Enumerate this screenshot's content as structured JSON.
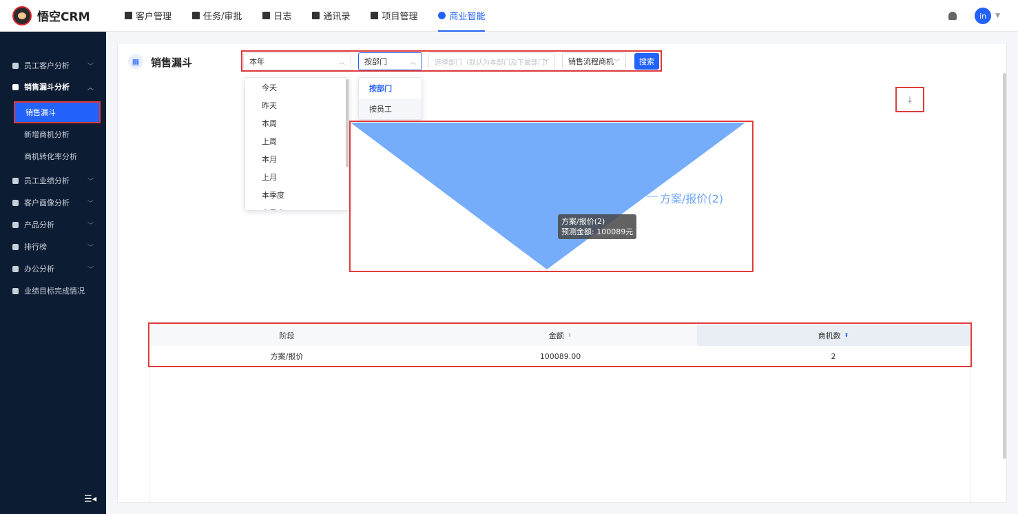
{
  "app": {
    "logo_text": "悟空CRM"
  },
  "nav": {
    "items": [
      {
        "label": "客户管理",
        "icon": "building-icon"
      },
      {
        "label": "任务/审批",
        "icon": "briefcase-icon"
      },
      {
        "label": "日志",
        "icon": "log-icon"
      },
      {
        "label": "通讯录",
        "icon": "contacts-icon"
      },
      {
        "label": "项目管理",
        "icon": "project-icon"
      },
      {
        "label": "商业智能",
        "icon": "bi-icon",
        "active": true
      }
    ]
  },
  "user": {
    "avatar_text": "in"
  },
  "sidebar": {
    "items": [
      {
        "label": "员工客户分析",
        "icon": "user-icon"
      },
      {
        "label": "销售漏斗分析",
        "icon": "funnel-icon",
        "open": true
      },
      {
        "label": "员工业绩分析",
        "icon": "bar-chart-icon"
      },
      {
        "label": "客户画像分析",
        "icon": "users-icon"
      },
      {
        "label": "产品分析",
        "icon": "box-icon"
      },
      {
        "label": "排行榜",
        "icon": "trophy-icon"
      },
      {
        "label": "办公分析",
        "icon": "briefcase-icon"
      },
      {
        "label": "业绩目标完成情况",
        "icon": "target-icon"
      }
    ],
    "sub_items": [
      "销售漏斗",
      "新增商机分析",
      "商机转化率分析"
    ],
    "collapse_glyph": "☰◂"
  },
  "page": {
    "title": "销售漏斗"
  },
  "filters": {
    "time_value": "本年",
    "group_value": "按部门",
    "dept_placeholder": "选择部门（默认为本部门及下属部门）",
    "flow_value": "销售流程商机",
    "search_label": "搜索"
  },
  "time_options": [
    "今天",
    "昨天",
    "本周",
    "上周",
    "本月",
    "上月",
    "本季度",
    "上季度"
  ],
  "group_options": [
    "按部门",
    "按员工"
  ],
  "download_glyph": "⤓",
  "chart_data": {
    "type": "funnel",
    "series": [
      {
        "stage": "方案/报价",
        "count": 2,
        "amount": 100089
      }
    ],
    "label": "方案/报价(2)",
    "tooltip_line1": "方案/报价(2)",
    "tooltip_line2": "预测金额: 100089元",
    "color": "#76adfb"
  },
  "table": {
    "headers": [
      "阶段",
      "金额",
      "商机数"
    ],
    "rows": [
      [
        "方案/报价",
        "100089.00",
        "2"
      ]
    ]
  }
}
